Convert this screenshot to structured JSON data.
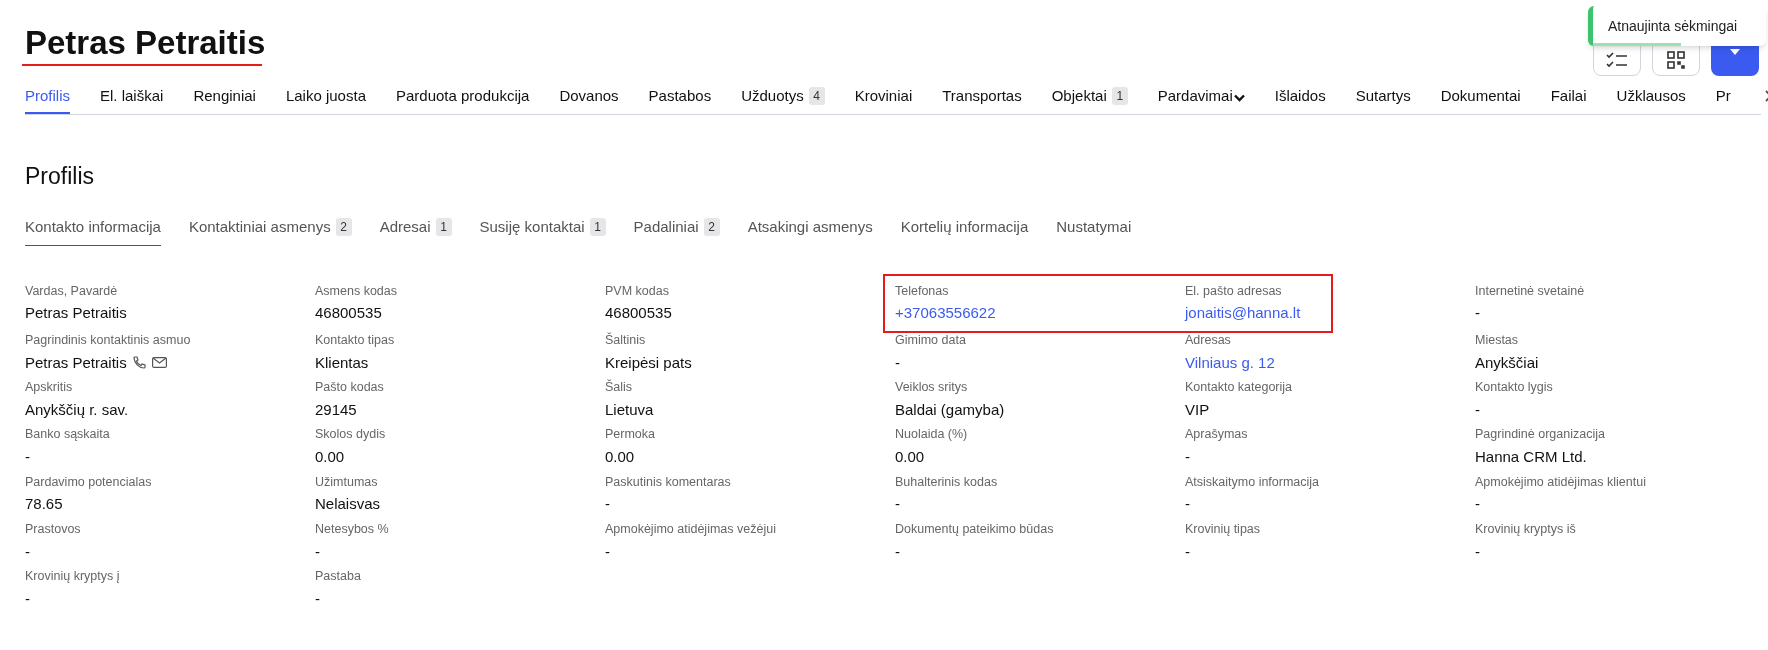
{
  "title": "Petras Petraitis",
  "title_underlined": true,
  "toast": {
    "message": "Atnaujinta sėkmingai",
    "level": 0.51
  },
  "tabs": [
    {
      "label": "Profilis",
      "selected": true
    },
    {
      "label": "El. laiškai",
      "selected": false
    },
    {
      "label": "Renginiai",
      "selected": false
    },
    {
      "label": "Laiko juosta",
      "selected": false
    },
    {
      "label": "Parduota produkcija",
      "selected": false
    },
    {
      "label": "Dovanos",
      "selected": false
    },
    {
      "label": "Pastabos",
      "selected": false
    },
    {
      "label": "Užduotys",
      "badge": "4",
      "selected": false
    },
    {
      "label": "Kroviniai",
      "selected": false
    },
    {
      "label": "Transportas",
      "selected": false
    },
    {
      "label": "Objektai",
      "badge": "1",
      "selected": false
    },
    {
      "label": "Pardavimai",
      "kind": "dropdown",
      "selected": false
    },
    {
      "label": "Išlaidos",
      "selected": false
    },
    {
      "label": "Sutartys",
      "selected": false
    },
    {
      "label": "Dokumentai",
      "selected": false
    },
    {
      "label": "Failai",
      "selected": false
    },
    {
      "label": "Užklausos",
      "selected": false
    },
    {
      "label": "Pr",
      "selected": false
    }
  ],
  "section_title": "Profilis",
  "subtabs": [
    {
      "label": "Kontakto informacija",
      "selected": true
    },
    {
      "label": "Kontaktiniai asmenys",
      "badge": "2",
      "selected": false
    },
    {
      "label": "Adresai",
      "badge": "1",
      "selected": false
    },
    {
      "label": "Susiję kontaktai",
      "badge": "1",
      "selected": false
    },
    {
      "label": "Padaliniai",
      "badge": "2",
      "selected": false
    },
    {
      "label": "Atsakingi asmenys",
      "selected": false
    },
    {
      "label": "Kortelių informacija",
      "selected": false
    },
    {
      "label": "Nustatymai",
      "selected": false
    }
  ],
  "fields": [
    {
      "label": "Vardas, Pavardė",
      "value": "Petras Petraitis"
    },
    {
      "label": "Asmens kodas",
      "value": "46800535"
    },
    {
      "label": "PVM kodas",
      "value": "46800535"
    },
    {
      "label": "Telefonas",
      "value": "+37063556622",
      "kind": "link",
      "highlighted": true
    },
    {
      "label": "El. pašto adresas",
      "value": "jonaitis@hanna.lt",
      "kind": "link",
      "highlighted": true
    },
    {
      "label": "Internetinė svetainė",
      "value": "-"
    },
    {
      "label": "Pagrindinis kontaktinis asmuo",
      "value": "Petras Petraitis",
      "contact_icons": true
    },
    {
      "label": "Kontakto tipas",
      "value": "Klientas"
    },
    {
      "label": "Šaltinis",
      "value": "Kreipėsi pats"
    },
    {
      "label": "Gimimo data",
      "value": "-"
    },
    {
      "label": "Adresas",
      "value": "Vilniaus g. 12",
      "kind": "link"
    },
    {
      "label": "Miestas",
      "value": "Anykščiai"
    },
    {
      "label": "Apskritis",
      "value": "Anykščių r. sav."
    },
    {
      "label": "Pašto kodas",
      "value": "29145"
    },
    {
      "label": "Šalis",
      "value": "Lietuva"
    },
    {
      "label": "Veiklos sritys",
      "value": "Baldai (gamyba)"
    },
    {
      "label": "Kontakto kategorija",
      "value": "VIP"
    },
    {
      "label": "Kontakto lygis",
      "value": "-"
    },
    {
      "label": "Banko sąskaita",
      "value": "-"
    },
    {
      "label": "Skolos dydis",
      "value": "0.00"
    },
    {
      "label": "Permoka",
      "value": "0.00"
    },
    {
      "label": "Nuolaida (%)",
      "value": "0.00"
    },
    {
      "label": "Aprašymas",
      "value": "-"
    },
    {
      "label": "Pagrindinė organizacija",
      "value": "Hanna CRM Ltd."
    },
    {
      "label": "Pardavimo potencialas",
      "value": "78.65"
    },
    {
      "label": "Užimtumas",
      "value": "Nelaisvas"
    },
    {
      "label": "Paskutinis komentaras",
      "value": "-"
    },
    {
      "label": "Buhalterinis kodas",
      "value": "-"
    },
    {
      "label": "Atsiskaitymo informacija",
      "value": "-"
    },
    {
      "label": "Apmokėjimo atidėjimas klientui",
      "value": "-"
    },
    {
      "label": "Prastovos",
      "value": "-"
    },
    {
      "label": "Netesybos %",
      "value": "-"
    },
    {
      "label": "Apmokėjimo atidėjimas vežėjui",
      "value": "-"
    },
    {
      "label": "Dokumentų pateikimo būdas",
      "value": "-"
    },
    {
      "label": "Krovinių tipas",
      "value": "-"
    },
    {
      "label": "Krovinių kryptys iš",
      "value": "-"
    },
    {
      "label": "Krovinių kryptys į",
      "value": "-"
    },
    {
      "label": "Pastaba",
      "value": "-"
    }
  ]
}
